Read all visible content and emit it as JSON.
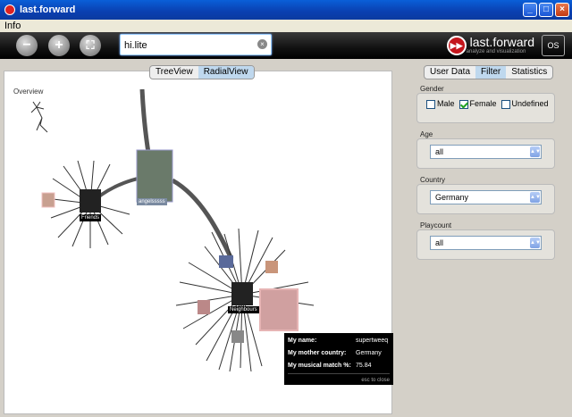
{
  "window": {
    "title": "last.forward"
  },
  "menu": {
    "items": [
      "Info"
    ]
  },
  "toolbar": {
    "zoom_out": "−",
    "zoom_in": "+",
    "fit": "⛶",
    "search": {
      "value": "hi.lite"
    },
    "brand_name": "last.forward",
    "brand_tagline": "analyze and visualization",
    "os_logo": "OS"
  },
  "view_tabs": [
    {
      "label": "TreeView"
    },
    {
      "label": "RadialView"
    }
  ],
  "overview_label": "Overview",
  "graph": {
    "friends_label": "Friends",
    "neighbours_label": "Neighbours",
    "user_label": "angelsssss"
  },
  "tooltip": {
    "rows": [
      {
        "key": "My name:",
        "value": "supertweeq"
      },
      {
        "key": "My mother country:",
        "value": "Germany"
      },
      {
        "key": "My musical match %:",
        "value": "75.84"
      }
    ],
    "close_hint": "esc to close"
  },
  "side_tabs": [
    {
      "label": "User Data"
    },
    {
      "label": "Filter"
    },
    {
      "label": "Statistics"
    }
  ],
  "filters": {
    "gender": {
      "label": "Gender",
      "options": [
        {
          "label": "Male",
          "checked": false
        },
        {
          "label": "Female",
          "checked": true
        },
        {
          "label": "Undefined",
          "checked": false
        }
      ]
    },
    "age": {
      "label": "Age",
      "value": "all"
    },
    "country": {
      "label": "Country",
      "value": "Germany"
    },
    "playcount": {
      "label": "Playcount",
      "value": "all"
    }
  }
}
